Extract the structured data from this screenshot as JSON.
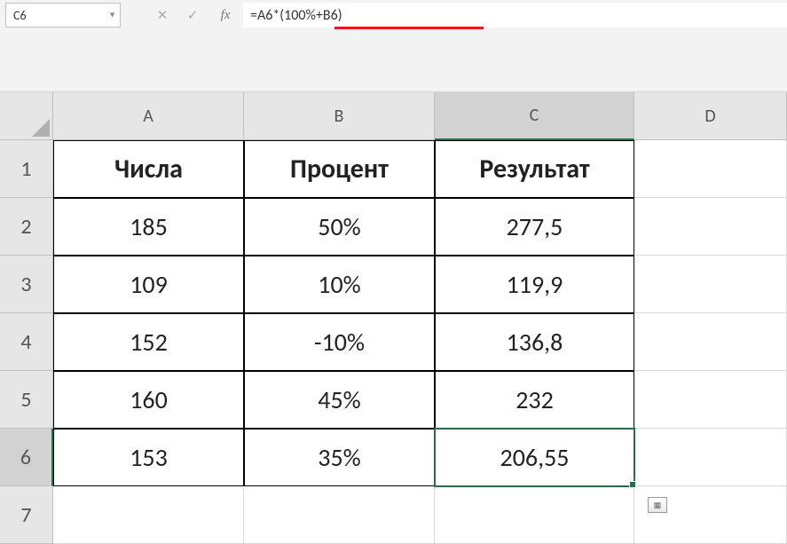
{
  "nameBox": "C6",
  "formulaBar": "=A6*(100%+B6)",
  "columns": [
    "A",
    "B",
    "C",
    "D"
  ],
  "rows": [
    "1",
    "2",
    "3",
    "4",
    "5",
    "6",
    "7"
  ],
  "activeCell": {
    "row": 6,
    "col": "C"
  },
  "headers": {
    "A1": "Числа",
    "B1": "Процент",
    "C1": "Результат"
  },
  "data": [
    {
      "A": "185",
      "B": "50%",
      "C": "277,5"
    },
    {
      "A": "109",
      "B": "10%",
      "C": "119,9"
    },
    {
      "A": "152",
      "B": "-10%",
      "C": "136,8"
    },
    {
      "A": "160",
      "B": "45%",
      "C": "232"
    },
    {
      "A": "153",
      "B": "35%",
      "C": "206,55"
    }
  ],
  "icons": {
    "cancel": "✕",
    "enter": "✓",
    "fx": "fx",
    "dropdown": "▼"
  }
}
